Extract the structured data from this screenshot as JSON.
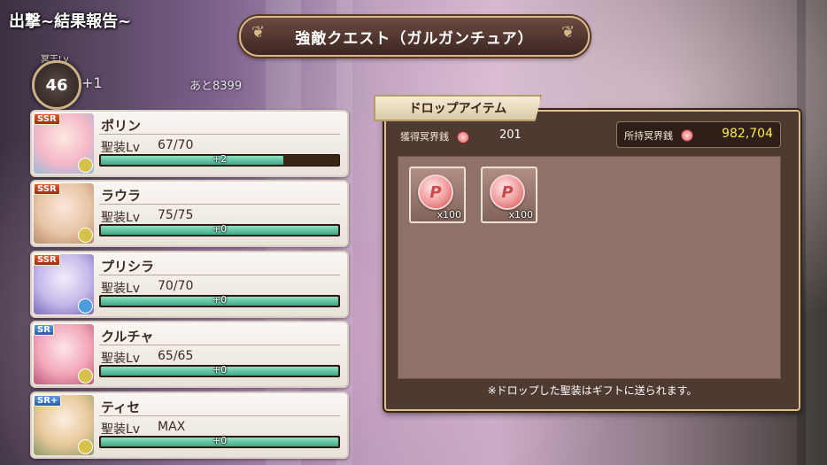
{
  "header": {
    "screen_label": "出撃~結果報告~",
    "quest_title": "強敵クエスト（ガルガンチュア）"
  },
  "player": {
    "level_caption": "冥王Lv",
    "level": "46",
    "level_gain": "+1",
    "exp_to_next": "あと8399"
  },
  "units": [
    {
      "name": "ポリン",
      "rarity": "SSR",
      "equip_label": "聖装Lv",
      "equip_value": "67/70",
      "exp_gain": "+2",
      "exp_fill": 0.77,
      "element_color": "#d6c24a"
    },
    {
      "name": "ラウラ",
      "rarity": "SSR",
      "equip_label": "聖装Lv",
      "equip_value": "75/75",
      "exp_gain": "+0",
      "exp_fill": 1.0,
      "element_color": "#d6c24a"
    },
    {
      "name": "プリシラ",
      "rarity": "SSR",
      "equip_label": "聖装Lv",
      "equip_value": "70/70",
      "exp_gain": "+0",
      "exp_fill": 1.0,
      "element_color": "#4a9ee0"
    },
    {
      "name": "クルチャ",
      "rarity": "SR",
      "equip_label": "聖装Lv",
      "equip_value": "65/65",
      "exp_gain": "+0",
      "exp_fill": 1.0,
      "element_color": "#d6c24a"
    },
    {
      "name": "ティセ",
      "rarity": "SR+",
      "equip_label": "聖装Lv",
      "equip_value": "MAX",
      "exp_gain": "+0",
      "exp_fill": 1.0,
      "element_color": "#d6c24a"
    }
  ],
  "drop_panel": {
    "tab_label": "ドロップアイテム",
    "earned_label": "獲得冥界銭",
    "earned_value": "201",
    "owned_label": "所持冥界銭",
    "owned_value": "982,704",
    "items": [
      {
        "icon": "meikai-coin-icon",
        "glyph": "P",
        "quantity": "x100"
      },
      {
        "icon": "meikai-coin-icon",
        "glyph": "P",
        "quantity": "x100"
      }
    ],
    "note": "※ドロップした聖装はギフトに送られます。"
  }
}
